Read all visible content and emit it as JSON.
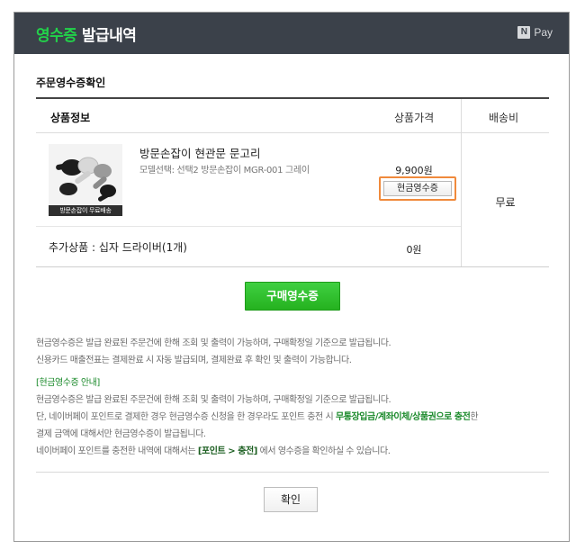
{
  "header": {
    "title_highlight": "영수증",
    "title_rest": "발급내역",
    "pay_logo_letter": "N",
    "pay_logo_text": "Pay"
  },
  "section_title": "주문영수증확인",
  "table": {
    "headers": {
      "product_info": "상품정보",
      "product_price": "상품가격",
      "shipping": "배송비"
    },
    "product": {
      "thumbnail_caption": "방문손잡이 무료배송",
      "name": "방문손잡이 현관문 문고리",
      "option": "모델선택: 선택2 방문손잡이 MGR-001 그레이",
      "price": "9,900원",
      "cash_receipt_button": "현금영수증"
    },
    "shipping_fee": "무료",
    "addon": {
      "label": "추가상품 : 십자 드라이버(1개)",
      "price": "0원"
    }
  },
  "buy_receipt_button": "구매영수증",
  "notes": {
    "line1": "현금영수증은 발급 완료된 주문건에 한해 조회 및 출력이 가능하며, 구매확정일 기준으로 발급됩니다.",
    "line2": "신용카드 매출전표는 결제완료 시 자동 발급되며, 결제완료 후 확인 및 출력이 가능합니다.",
    "guide_title": "[현금영수증 안내]",
    "guide1": "현금영수증은 발급 완료된 주문건에 한해 조회 및 출력이 가능하며, 구매확정일 기준으로 발급됩니다.",
    "guide2_pre": "단, 네이버페이 포인트로 결제한 경우 현금영수증 신청을 한 경우라도 포인트 충전 시 ",
    "guide2_emph": "무통장입금/계좌이체/상품권으로 충전",
    "guide2_post": "한",
    "guide3": "결제 금액에 대해서만 현금영수증이 발급됩니다.",
    "guide4_pre": "네이버페이 포인트를 충전한 내역에 대해서는 ",
    "guide4_emph": "[포인트 > 충전]",
    "guide4_post": " 에서 영수증을 확인하실 수 있습니다."
  },
  "confirm_button": "확인",
  "colors": {
    "header_bg": "#3b414a",
    "accent_green": "#22d34a",
    "button_green": "#2bbd27",
    "highlight_orange": "#f08a3c"
  }
}
